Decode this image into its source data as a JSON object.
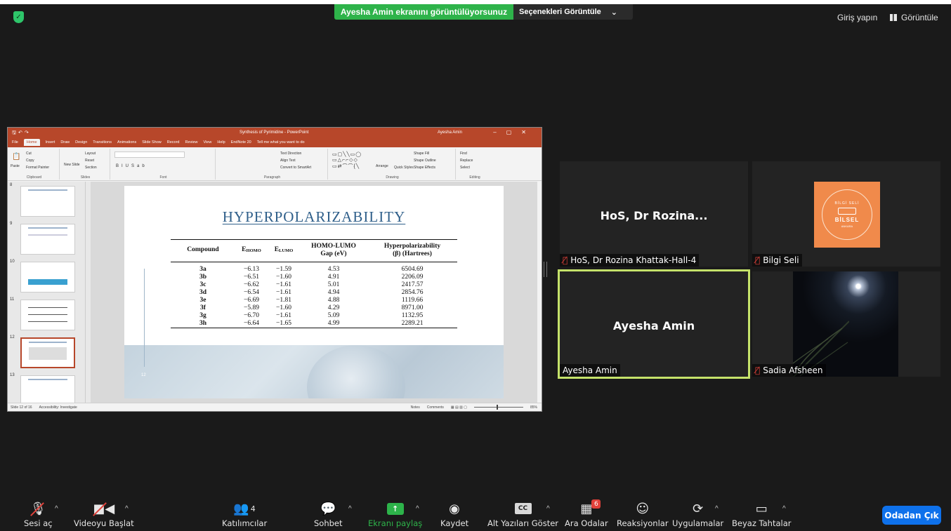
{
  "top": {
    "banner": "Ayesha Amin ekranını görüntülüyorsunuz",
    "view_options": "Seçenekleri Görüntüle",
    "signin": "Giriş yapın",
    "view": "Görüntüle"
  },
  "ppt": {
    "doc_title": "Synthesis of Pyrimidine  -  PowerPoint",
    "user": "Ayesha Amin",
    "tabs": [
      "File",
      "Home",
      "Insert",
      "Draw",
      "Design",
      "Transitions",
      "Animations",
      "Slide Show",
      "Record",
      "Review",
      "View",
      "Help",
      "EndNote 20",
      "Tell me what you want to do"
    ],
    "ribbon": {
      "clipboard": "Clipboard",
      "paste": "Paste",
      "cut": "Cut",
      "copy": "Copy",
      "format_painter": "Format Painter",
      "slides": "Slides",
      "new_slide": "New Slide",
      "layout": "Layout",
      "reset": "Reset",
      "section": "Section",
      "font": "Font",
      "paragraph": "Paragraph",
      "text_direction": "Text Direction",
      "align_text": "Align Text",
      "convert": "Convert to SmartArt",
      "drawing": "Drawing",
      "arrange": "Arrange",
      "quick_styles": "Quick Styles",
      "shape_fill": "Shape Fill",
      "shape_outline": "Shape Outline",
      "shape_effects": "Shape Effects",
      "editing": "Editing",
      "find": "Find",
      "replace": "Replace",
      "select": "Select"
    },
    "thumbs": [
      "8",
      "9",
      "10",
      "11",
      "12",
      "13"
    ],
    "slide": {
      "title": "HYPERPOLARIZABILITY",
      "number": "12",
      "headers": {
        "compound": "Compound",
        "ehomo": "E",
        "ehomo_sub": "HOMO",
        "elumo": "E",
        "elumo_sub": "LUMO",
        "gap1": "HOMO-LUMO",
        "gap2": "Gap (eV)",
        "hyp1": "Hyperpolarizability",
        "hyp2": "(β) (Hartrees)"
      },
      "rows": [
        [
          "3a",
          "−6.13",
          "−1.59",
          "4.53",
          "6504.69"
        ],
        [
          "3b",
          "−6.51",
          "−1.60",
          "4.91",
          "2206.09"
        ],
        [
          "3c",
          "−6.62",
          "−1.61",
          "5.01",
          "2417.57"
        ],
        [
          "3d",
          "−6.54",
          "−1.61",
          "4.94",
          "2854.76"
        ],
        [
          "3e",
          "−6.69",
          "−1.81",
          "4.88",
          "1119.66"
        ],
        [
          "3f",
          "−5.89",
          "−1.60",
          "4.29",
          "8971.00"
        ],
        [
          "3g",
          "−6.70",
          "−1.61",
          "5.09",
          "1132.95"
        ],
        [
          "3h",
          "−6.64",
          "−1.65",
          "4.99",
          "2289.21"
        ]
      ]
    },
    "status": {
      "slide_of": "Slide 12 of 16",
      "accessibility": "Accessibility: Investigate",
      "notes": "Notes",
      "comments": "Comments",
      "zoom": "85%"
    }
  },
  "participants": {
    "hos_center": "HoS, Dr Rozina...",
    "hos_name": "HoS, Dr Rozina Khattak-Hall-4",
    "bilgi_name": "Bilgi Seli",
    "bilgi_logo_top": "BİLGİ SELİ",
    "bilgi_logo_main": "BİLSEL",
    "bilgi_logo_bottom": "ANKARA",
    "ayesha_center": "Ayesha Amin",
    "ayesha_name": "Ayesha Amin",
    "sadia_name": "Sadia Afsheen"
  },
  "toolbar": {
    "mute": "Sesi aç",
    "video": "Videoyu Başlat",
    "participants": "Katılımcılar",
    "participants_count": "4",
    "chat": "Sohbet",
    "share": "Ekranı paylaş",
    "record": "Kaydet",
    "captions": "Alt Yazıları Göster",
    "cc": "CC",
    "breakout": "Ara Odalar",
    "breakout_badge": "6",
    "reactions": "Reaksiyonlar",
    "apps": "Uygulamalar",
    "whiteboard": "Beyaz Tahtalar",
    "leave": "Odadan Çık"
  },
  "colors": {
    "share_green": "#2eb34a",
    "ppt_red": "#b7472a",
    "active_speaker": "#c5e26a",
    "leave_blue": "#0e71eb",
    "mute_red": "#e0413a"
  }
}
